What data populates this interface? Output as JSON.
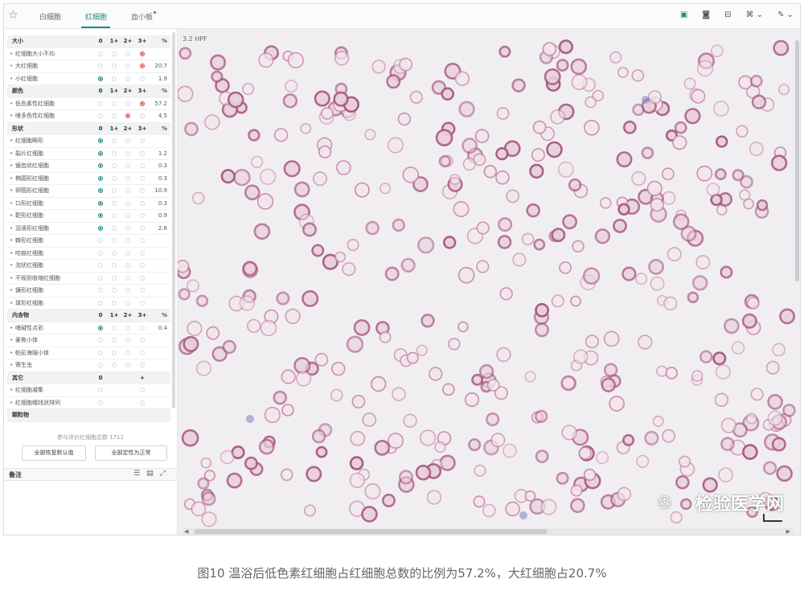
{
  "tabs": [
    {
      "label": "白细胞"
    },
    {
      "label": "红细胞"
    },
    {
      "label": "血小板"
    }
  ],
  "toolbar": {
    "icons": [
      "image-icon",
      "camera-icon",
      "measure-icon",
      "layers-icon",
      "chevron-down-icon",
      "brush-icon",
      "chevron-down-icon"
    ]
  },
  "table": {
    "col_labels": {
      "c0": "0",
      "c1": "1+",
      "c2": "2+",
      "c3": "3+",
      "pct": "%"
    },
    "rows": [
      {
        "type": "header",
        "name": "大小",
        "cols": true
      },
      {
        "type": "item",
        "name": "红细胞大小不均",
        "sel": 3,
        "color": "red",
        "pct": ""
      },
      {
        "type": "item",
        "name": "大红细胞",
        "sel": 3,
        "color": "red",
        "pct": "20.7"
      },
      {
        "type": "item",
        "name": "小红细胞",
        "sel": 0,
        "color": "teal",
        "pct": "1.9"
      },
      {
        "type": "header",
        "name": "颜色",
        "cols": true
      },
      {
        "type": "item",
        "name": "低色素性红细胞",
        "sel": 3,
        "color": "red",
        "pct": "57.2"
      },
      {
        "type": "item",
        "name": "嗜多色性红细胞",
        "sel": 2,
        "color": "red",
        "pct": "4.5"
      },
      {
        "type": "header",
        "name": "形状",
        "cols": true
      },
      {
        "type": "item",
        "name": "红细胞畸形",
        "sel": 0,
        "color": "teal",
        "pct": ""
      },
      {
        "type": "item",
        "name": "裂片红细胞",
        "sel": 0,
        "color": "teal",
        "pct": "1.2"
      },
      {
        "type": "item",
        "name": "锯齿状红细胞",
        "sel": 0,
        "color": "teal",
        "pct": "0.3"
      },
      {
        "type": "item",
        "name": "椭圆形红细胞",
        "sel": 0,
        "color": "teal",
        "pct": "0.3"
      },
      {
        "type": "item",
        "name": "卵圆形红细胞",
        "sel": 0,
        "color": "teal",
        "pct": "10.9"
      },
      {
        "type": "item",
        "name": "口形红细胞",
        "sel": 0,
        "color": "teal",
        "pct": "0.3"
      },
      {
        "type": "item",
        "name": "靶形红细胞",
        "sel": 0,
        "color": "teal",
        "pct": "0.9"
      },
      {
        "type": "item",
        "name": "泪滴形红细胞",
        "sel": 0,
        "color": "teal",
        "pct": "2.6"
      },
      {
        "type": "item",
        "name": "棘形红细胞",
        "sel": -1,
        "color": "",
        "pct": ""
      },
      {
        "type": "item",
        "name": "咬痕红细胞",
        "sel": -1,
        "color": "",
        "pct": ""
      },
      {
        "type": "item",
        "name": "泡状红细胞",
        "sel": -1,
        "color": "",
        "pct": ""
      },
      {
        "type": "item",
        "name": "不规则收缩红细胞",
        "sel": -1,
        "color": "",
        "pct": ""
      },
      {
        "type": "item",
        "name": "镰形红细胞",
        "sel": -1,
        "color": "",
        "pct": ""
      },
      {
        "type": "item",
        "name": "球形红细胞",
        "sel": -1,
        "color": "",
        "pct": ""
      },
      {
        "type": "header",
        "name": "内含物",
        "cols": true
      },
      {
        "type": "item",
        "name": "嗜碱性点彩",
        "sel": 0,
        "color": "teal",
        "pct": "0.4"
      },
      {
        "type": "item",
        "name": "豪焦小体",
        "sel": -1,
        "color": "",
        "pct": ""
      },
      {
        "type": "item",
        "name": "帕彭海姆小体",
        "sel": -1,
        "color": "",
        "pct": ""
      },
      {
        "type": "item",
        "name": "寄生虫",
        "sel": -1,
        "color": "",
        "pct": ""
      },
      {
        "type": "header",
        "name": "其它",
        "cols": false,
        "c0": "0",
        "c1": "+"
      },
      {
        "type": "item",
        "name": "红细胞凝集",
        "sel": -1,
        "color": "",
        "pct": "",
        "two": true
      },
      {
        "type": "item",
        "name": "红细胞缗钱状排列",
        "sel": -1,
        "color": "",
        "pct": "",
        "two": true
      },
      {
        "type": "header",
        "name": "颗粒物",
        "cols": false
      }
    ]
  },
  "count_text": "参与评价红细胞总数 1712",
  "buttons": {
    "reset": "全部恢复默认值",
    "normal": "全部定性为正常"
  },
  "notes": {
    "title": "备注"
  },
  "viewer": {
    "hpf": "3.2 HPF"
  },
  "watermark": {
    "text": "检验医学网"
  },
  "caption": "图10 温浴后低色素红细胞占红细胞总数的比例为57.2%，大红细胞占20.7%",
  "colors": {
    "accent": "#1f8a8a",
    "red": "#e0443b",
    "cell": "#c88aa6"
  }
}
